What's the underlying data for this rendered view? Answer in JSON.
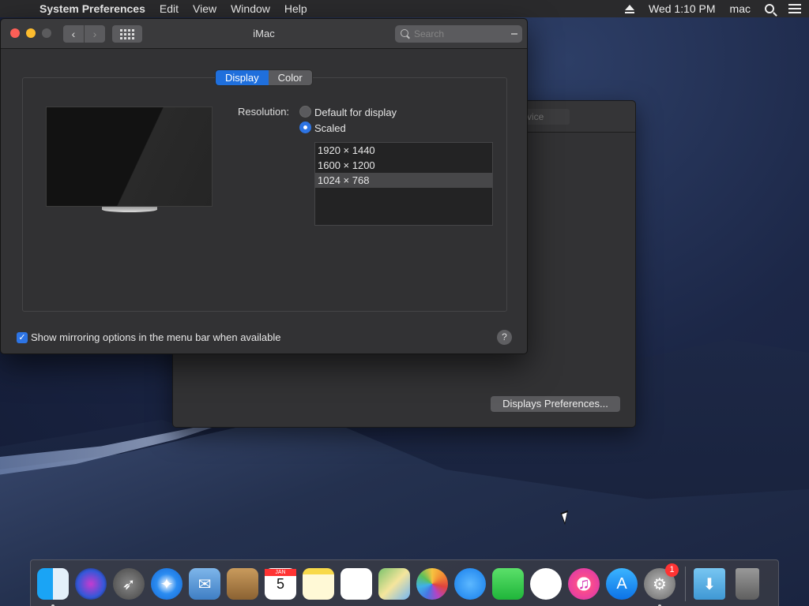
{
  "menubar": {
    "app_name": "System Preferences",
    "menus": [
      "Edit",
      "View",
      "Window",
      "Help"
    ],
    "clock": "Wed 1:10 PM",
    "user": "mac"
  },
  "window": {
    "title": "iMac",
    "search_placeholder": "Search",
    "tabs": [
      {
        "label": "Display",
        "selected": true
      },
      {
        "label": "Color",
        "selected": false
      }
    ],
    "resolution": {
      "label": "Resolution:",
      "options": [
        {
          "label": "Default for display",
          "selected": false
        },
        {
          "label": "Scaled",
          "selected": true
        }
      ],
      "scaled_list": [
        {
          "label": "1920 × 1440",
          "selected": false
        },
        {
          "label": "1600 × 1200",
          "selected": false
        },
        {
          "label": "1024 × 768",
          "selected": true
        }
      ]
    },
    "mirroring_checkbox": {
      "label": "Show mirroring options in the menu bar when available",
      "checked": true
    },
    "help_label": "?"
  },
  "back_window": {
    "tab_fragment": "vice",
    "button_label": "Displays Preferences..."
  },
  "dock": {
    "items": [
      "Finder",
      "Siri",
      "Launchpad",
      "Safari",
      "Mail",
      "Contacts",
      "Calendar",
      "Notes",
      "Reminders",
      "Maps",
      "Photos",
      "Messages",
      "FaceTime",
      "News",
      "iTunes",
      "App Store",
      "System Preferences",
      "Downloads",
      "Trash"
    ],
    "calendar_day": "5",
    "syspref_badge": "1"
  },
  "colors": {
    "accent": "#1f6fdc",
    "window_bg": "#323234",
    "close": "#fc5f57",
    "minimize": "#fdbc2e"
  }
}
